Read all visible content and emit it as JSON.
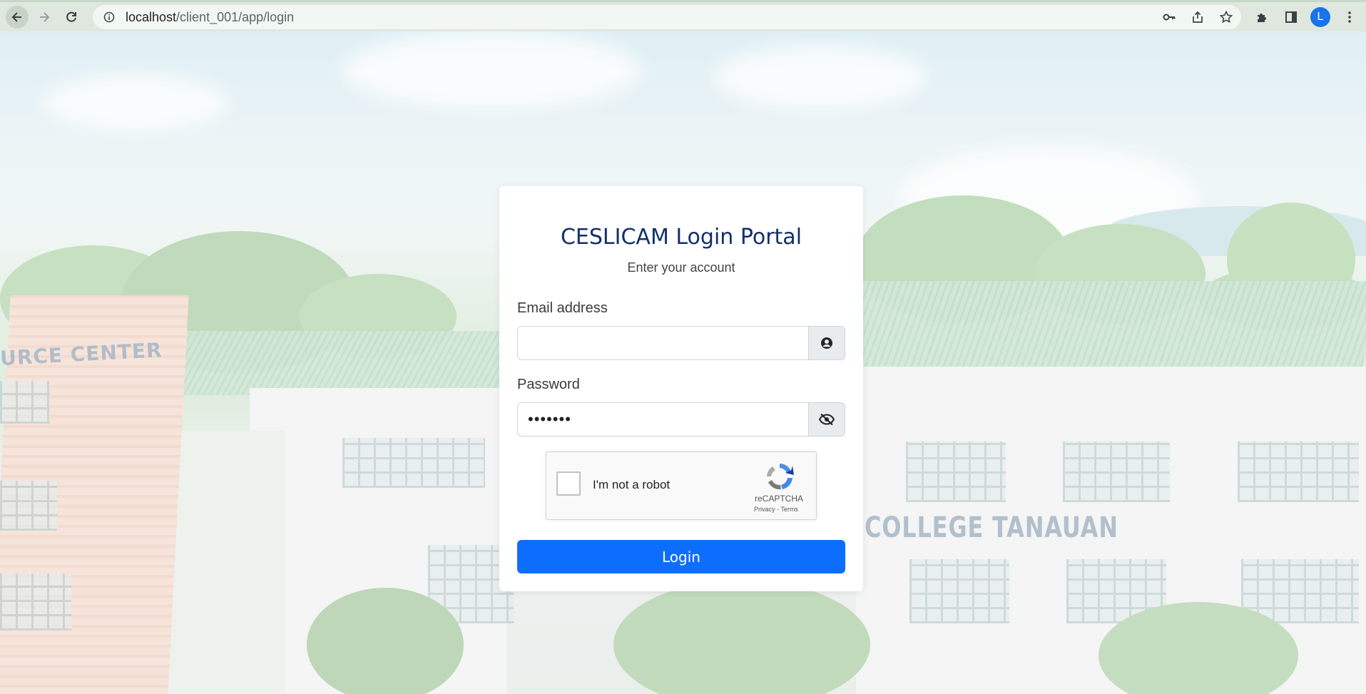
{
  "browser": {
    "url_host": "localhost",
    "url_path": "/client_001/app/login",
    "profile_initial": "L"
  },
  "background": {
    "sign_left": "URCE CENTER",
    "sign_right": "COLLEGE TANAUAN"
  },
  "card": {
    "title": "CESLICAM Login Portal",
    "subtitle": "Enter your account",
    "email_label": "Email address",
    "email_value": "",
    "email_icon": "user-circle-icon",
    "password_label": "Password",
    "password_value": "•••••••",
    "password_icon": "eye-slash-icon",
    "recaptcha_label": "I'm not a robot",
    "recaptcha_brand": "reCAPTCHA",
    "recaptcha_links": "Privacy - Terms",
    "login_label": "Login"
  },
  "colors": {
    "title": "#13306b",
    "primary_button": "#0d6efd"
  }
}
